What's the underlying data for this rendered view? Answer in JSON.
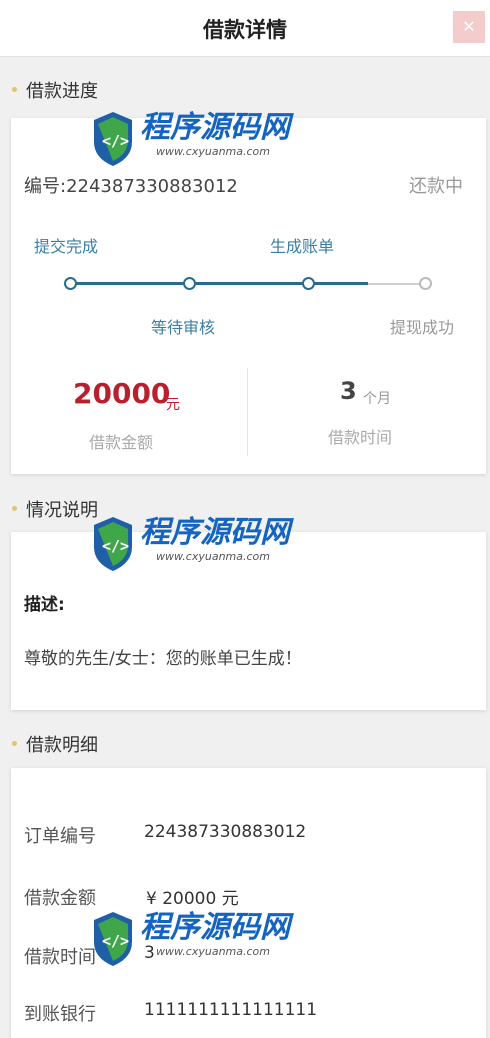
{
  "header": {
    "title": "借款详情",
    "close_icon": "close-icon"
  },
  "progress": {
    "section_title": "借款进度",
    "order_no": "编号:224387330883012",
    "status": "还款中",
    "steps": [
      {
        "label": "提交完成",
        "done": true
      },
      {
        "label": "等待审核",
        "done": true
      },
      {
        "label": "生成账单",
        "done": true
      },
      {
        "label": "提现成功",
        "done": false
      }
    ],
    "amount_value": "20000",
    "amount_unit": "元",
    "amount_label": "借款金额",
    "term_value": "3",
    "term_unit": "个月",
    "term_label": "借款时间"
  },
  "situation": {
    "section_title": "情况说明",
    "desc_label": "描述:",
    "desc_text": "尊敬的先生/女士：您的账单已生成！"
  },
  "details": {
    "section_title": "借款明细",
    "rows": [
      {
        "label": "订单编号",
        "value": "224387330883012"
      },
      {
        "label": "借款金额",
        "value": "¥ 20000 元"
      },
      {
        "label": "借款时间",
        "value": "3"
      },
      {
        "label": "到账银行",
        "value": "1111111111111111"
      }
    ]
  },
  "watermark": {
    "title": "程序源码网",
    "url": "www.cxyuanma.com"
  },
  "colors": {
    "accent": "#2a6a8e",
    "amount": "#b8202e",
    "step_text": "#3a7fa5",
    "muted": "#999999"
  }
}
